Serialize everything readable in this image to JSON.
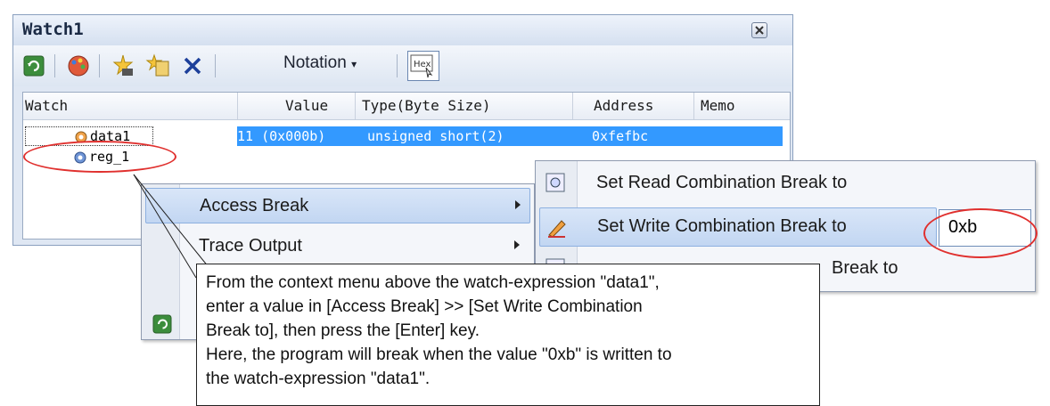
{
  "window": {
    "title": "Watch1"
  },
  "toolbar": {
    "notation_label": "Notation",
    "hex_label": "Hex",
    "icons": [
      "refresh-icon",
      "palette-icon",
      "add-watch-icon",
      "new-category-icon",
      "delete-icon"
    ]
  },
  "grid": {
    "columns": [
      "Watch",
      "Value",
      "Type(Byte Size)",
      "Address",
      "Memo"
    ],
    "rows": [
      {
        "name": "data1",
        "value": "11 (0x000b)",
        "type": "unsigned short(2)",
        "address": "0xfefbc",
        "selected": true
      },
      {
        "name": "reg_1"
      }
    ]
  },
  "context_menu": {
    "items": [
      {
        "label": "Access Break",
        "has_submenu": true,
        "highlighted": true
      },
      {
        "label": "Trace Output",
        "has_submenu": true,
        "highlighted": false
      }
    ]
  },
  "submenu": {
    "items": [
      {
        "label": "Set Read Combination Break to",
        "highlighted": false,
        "icon": "read-break-icon"
      },
      {
        "label": "Set Write Combination Break to",
        "highlighted": true,
        "icon": "write-break-icon"
      },
      {
        "label": "Break to",
        "highlighted": false,
        "icon": "access-break-icon"
      }
    ],
    "input_value": "0xb"
  },
  "callout": {
    "lines": [
      "From the context menu above the watch-expression \"data1\",",
      "enter a value in [Access Break] >> [Set Write Combination",
      "Break to], then press the [Enter] key.",
      "Here, the program will break when the value \"0xb\" is written to",
      "the watch-expression \"data1\"."
    ]
  },
  "colors": {
    "selection": "#3399ff",
    "highlight_ring": "#e0302e"
  }
}
